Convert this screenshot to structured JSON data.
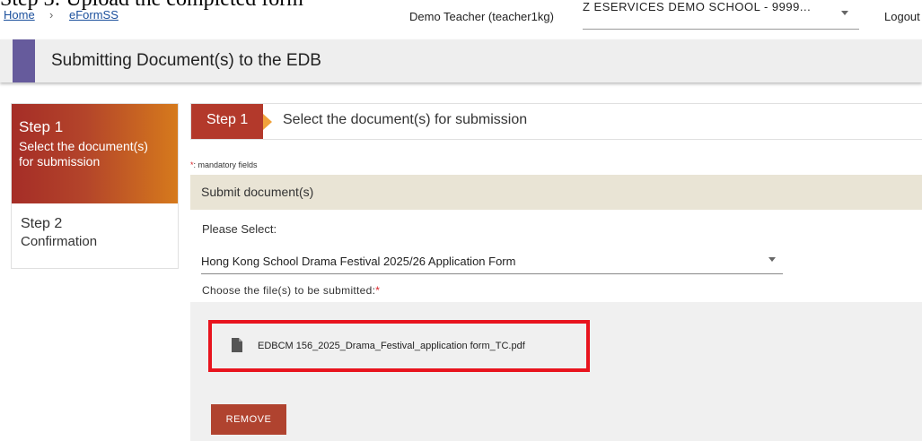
{
  "clipped_caption": "Step 3: Upload the completed form",
  "breadcrumb": {
    "home": "Home",
    "separator": "›",
    "eformss": "eFormSS"
  },
  "header": {
    "user": "Demo Teacher (teacher1kg)",
    "school": "Z ESERVICES DEMO SCHOOL - 9999...",
    "logout": "Logout"
  },
  "page_title": "Submitting Document(s) to the EDB",
  "steps": [
    {
      "num": "Step 1",
      "desc": "Select the document(s) for submission",
      "active": true
    },
    {
      "num": "Step 2",
      "desc": "Confirmation",
      "active": false
    }
  ],
  "step_header": {
    "tag": "Step 1",
    "text": "Select the document(s) for submission"
  },
  "mandatory": {
    "star": "*",
    "text": ": mandatory fields"
  },
  "section_title": "Submit document(s)",
  "form": {
    "please_select": "Please Select:",
    "selected_document": "Hong Kong School Drama Festival 2025/26 Application Form",
    "choose_files": "Choose the file(s) to be submitted:",
    "choose_star": "*"
  },
  "file": {
    "name": "EDBCM 156_2025_Drama_Festival_application form_TC.pdf",
    "icon": "file-icon"
  },
  "remove_label": "REMOVE",
  "colors": {
    "accent": "#665b9c",
    "step_active": "#b3392b",
    "highlight": "#e8141e",
    "remove": "#b0432f"
  }
}
